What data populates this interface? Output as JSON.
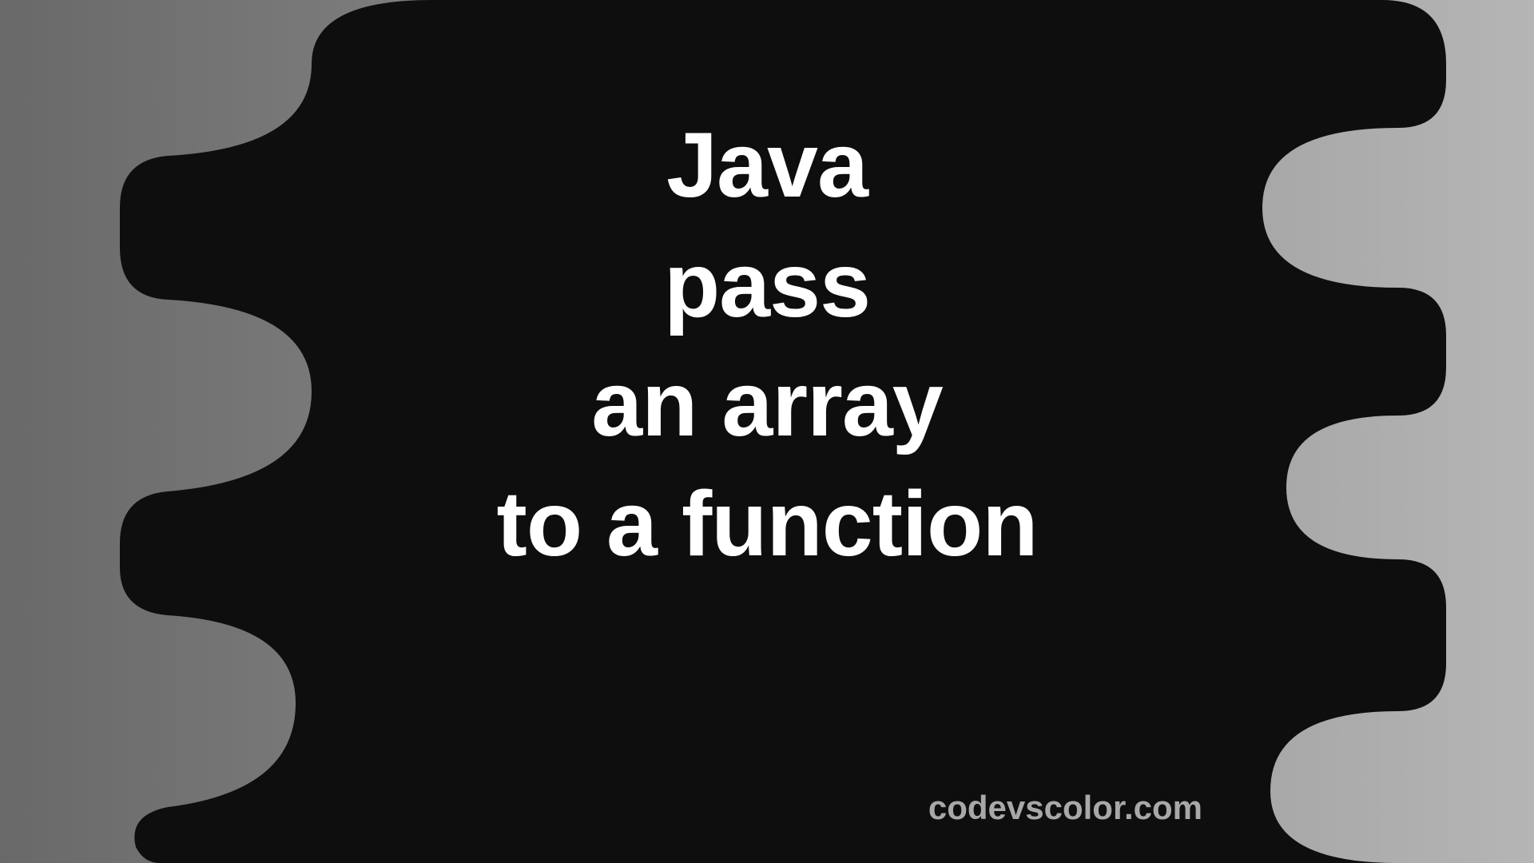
{
  "title": {
    "line1": "Java",
    "line2": "pass",
    "line3": "an array",
    "line4": "to a function"
  },
  "watermark": "codevscolor.com",
  "colors": {
    "blob_fill": "#0e0e0e",
    "text": "#ffffff",
    "watermark_text": "#a8a8a8",
    "bg_gradient_start": "#696969",
    "bg_gradient_end": "#b5b5b5"
  }
}
